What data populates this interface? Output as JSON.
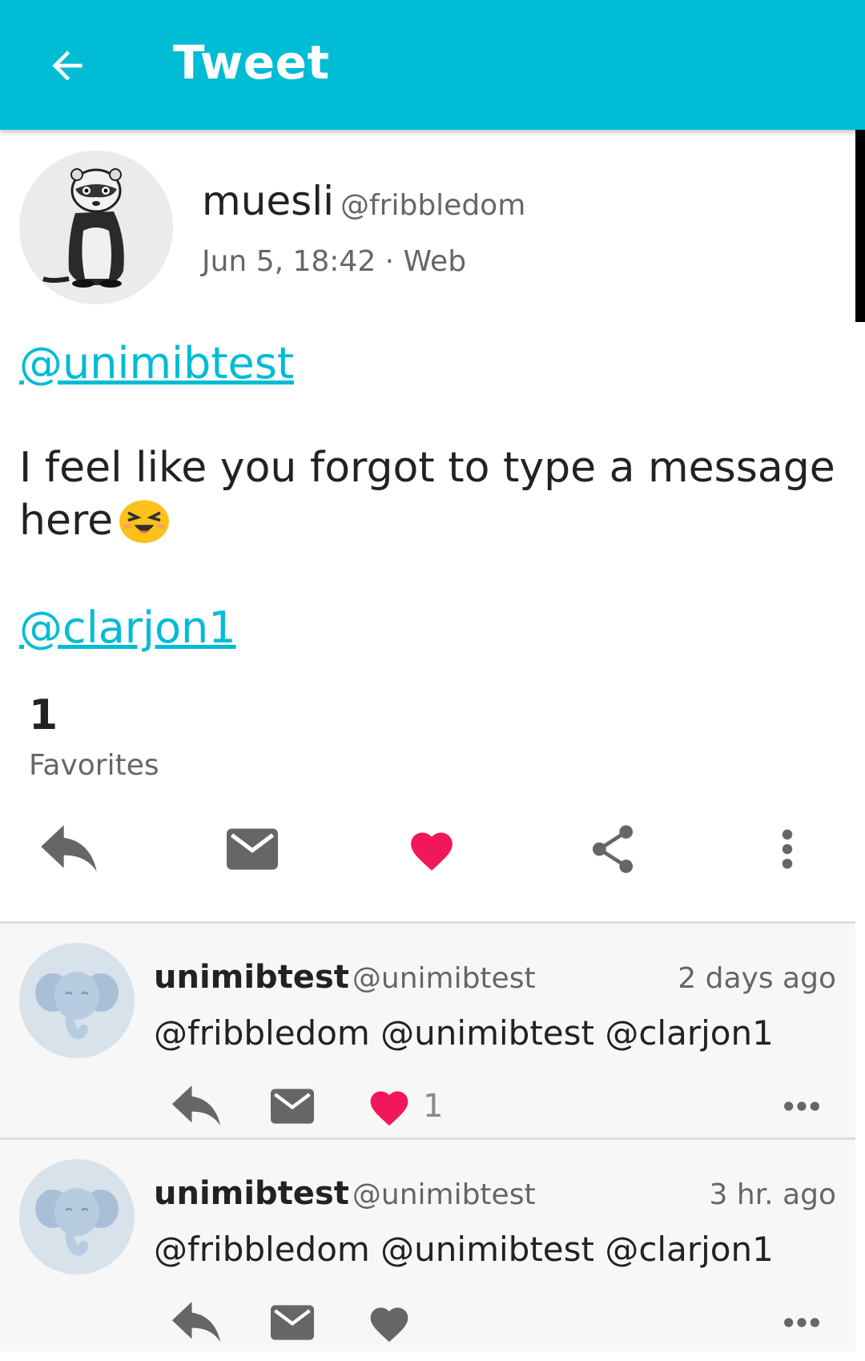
{
  "appbar": {
    "title": "Tweet",
    "color": "#00bcd4"
  },
  "tweet": {
    "author_name": "muesli",
    "author_handle": "@fribbledom",
    "meta": "Jun 5, 18:42 · Web",
    "mention_top": "@unimibtest",
    "text": "I feel like you forgot to type a message here",
    "mention_bottom": "@clarjon1",
    "favorites_count": "1",
    "favorites_label": "Favorites",
    "liked": true,
    "like_color": "#f1175a"
  },
  "replies": [
    {
      "name": "unimibtest",
      "handle": "@unimibtest",
      "time": "2 days ago",
      "text": "@fribbledom @unimibtest @clarjon1",
      "like_count": "1",
      "liked": true
    },
    {
      "name": "unimibtest",
      "handle": "@unimibtest",
      "time": "3 hr. ago",
      "text": "@fribbledom @unimibtest @clarjon1",
      "liked": false
    }
  ]
}
